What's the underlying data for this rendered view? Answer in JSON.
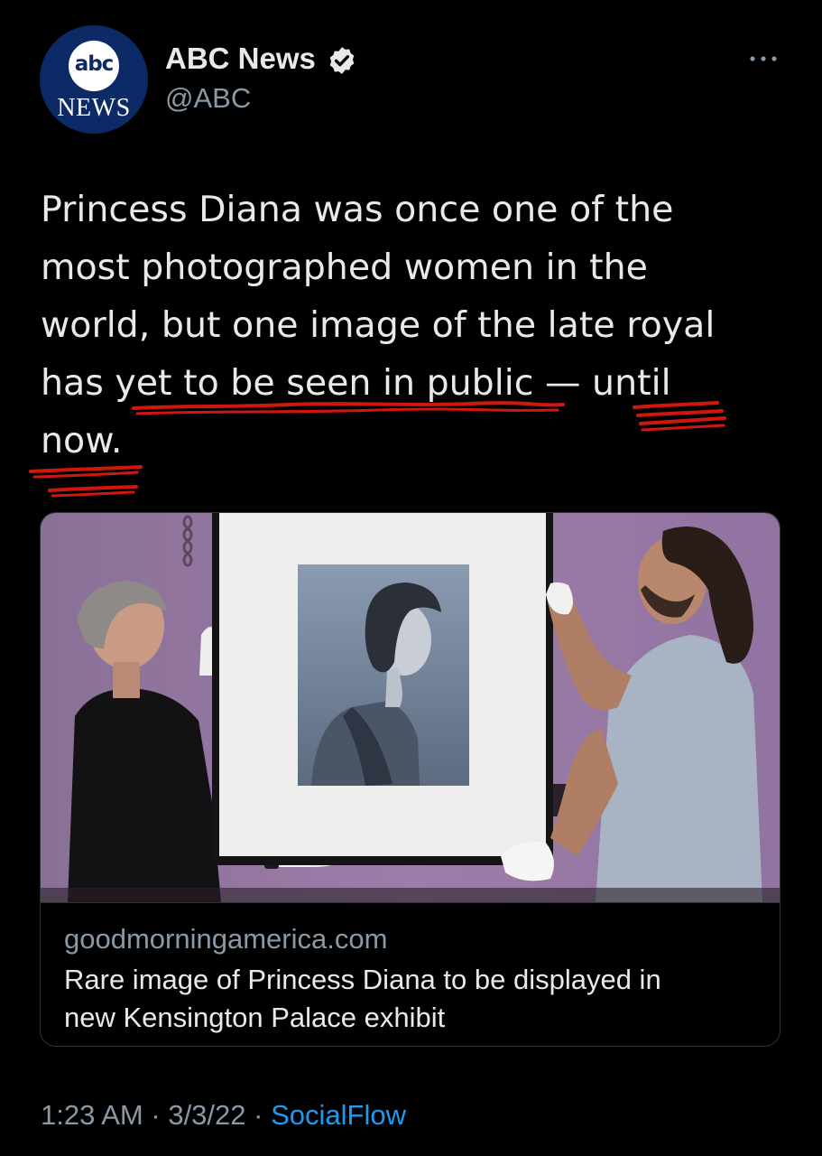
{
  "author": {
    "avatar_logo_text": "abc",
    "avatar_sub_text": "NEWS",
    "name": "ABC News",
    "handle": "@ABC",
    "verified": true
  },
  "tweet": {
    "text_lines": [
      "Princess Diana was once one of the",
      "most photographed women in the",
      "world, but one image of the late royal",
      "has yet to be seen in public — until",
      "now."
    ]
  },
  "card": {
    "domain": "goodmorningamerica.com",
    "title_lines": [
      "Rare image of Princess Diana to be displayed in",
      "new Kensington Palace exhibit"
    ]
  },
  "meta": {
    "time": "1:23 AM",
    "separator": "·",
    "date": "3/3/22",
    "source": "SocialFlow"
  },
  "colors": {
    "background": "#000000",
    "text": "#e7e9ea",
    "secondary_text": "#8b98a5",
    "link": "#1d9bf0",
    "verified_badge": "#e7e9ea",
    "annotation_scribble": "#d0170f",
    "avatar_bg": "#0c2a66"
  },
  "icons": {
    "verified": "verified-badge-icon",
    "more": "more-options-icon"
  }
}
